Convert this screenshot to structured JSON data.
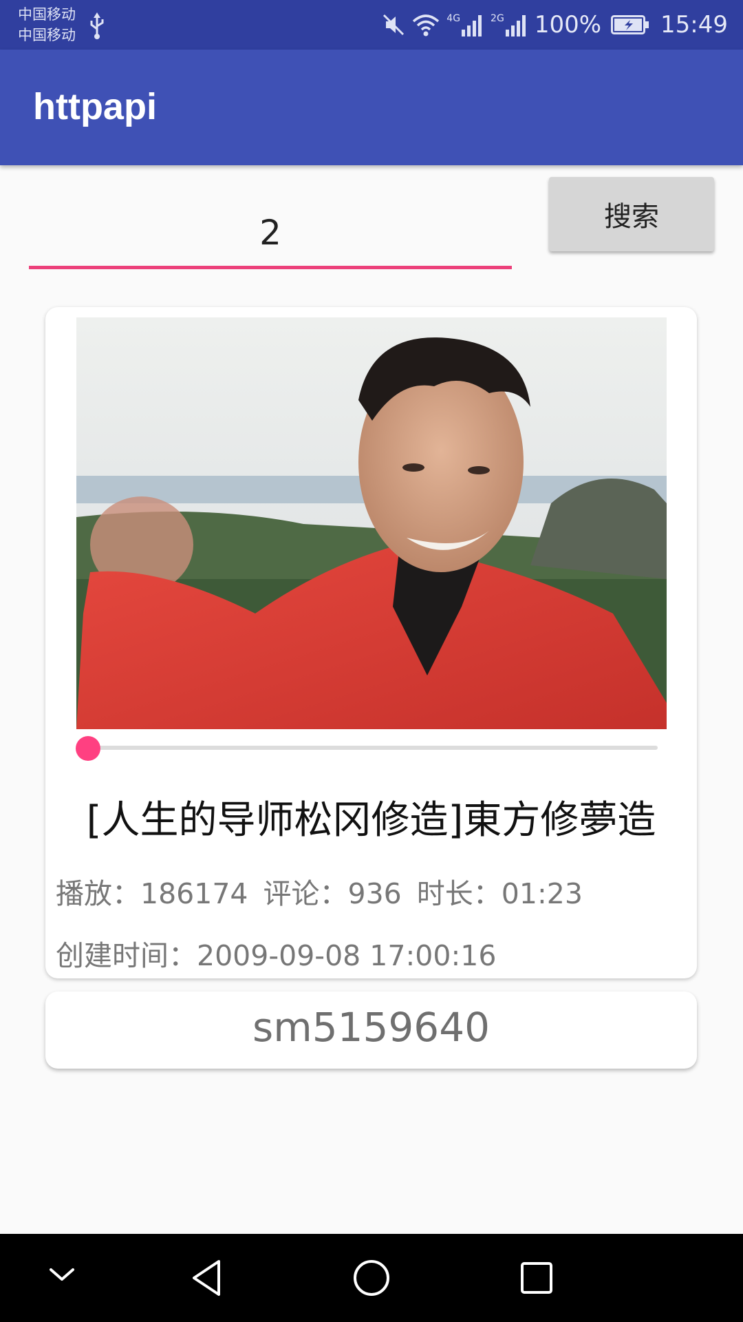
{
  "status_bar": {
    "carrier_1": "中国移动",
    "carrier_2": "中国移动",
    "signal_1_label": "4G",
    "signal_2_label": "2G",
    "battery": "100%",
    "time": "15:49",
    "icons": [
      "usb-icon",
      "mute-icon",
      "wifi-icon",
      "signal-icon",
      "signal-icon",
      "battery-icon"
    ]
  },
  "app_bar": {
    "title": "httpapi"
  },
  "search": {
    "value": "2",
    "button_label": "搜索"
  },
  "result": {
    "title": "[人生的导师松冈修造]東方修夢造",
    "play_count": "播放：186174",
    "comment_count": "评论：936",
    "duration": "时长：01:23",
    "created": "创建时间：2009-09-08 17:00:16",
    "progress_fraction": 0,
    "video_id": "sm5159640"
  },
  "colors": {
    "status_bar": "#303f9f",
    "primary": "#3f51b5",
    "accent": "#ff4081",
    "underline": "#ec407a"
  },
  "nav_bar": {
    "icons": [
      "chevron-down-icon",
      "back-icon",
      "home-icon",
      "recents-icon"
    ]
  }
}
